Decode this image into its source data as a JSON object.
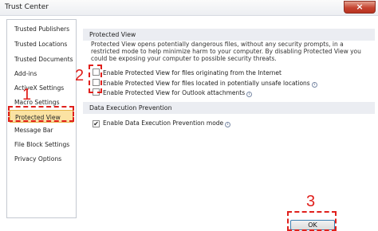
{
  "window": {
    "title": "Trust Center",
    "close_glyph": "×"
  },
  "sidebar": {
    "items": [
      {
        "label": "Trusted Publishers"
      },
      {
        "label": "Trusted Locations"
      },
      {
        "label": "Trusted Documents"
      },
      {
        "label": "Add-ins"
      },
      {
        "label": "ActiveX Settings"
      },
      {
        "label": "Macro Settings"
      },
      {
        "label": "Protected View",
        "selected": true
      },
      {
        "label": "Message Bar"
      },
      {
        "label": "File Block Settings"
      },
      {
        "label": "Privacy Options"
      }
    ]
  },
  "protected_view": {
    "header": "Protected View",
    "description": "Protected View opens potentially dangerous files, without any security prompts, in a restricted mode to help minimize harm to your computer. By disabling Protected View you could be exposing your computer to possible security threats.",
    "options": [
      {
        "label": "Enable Protected View for files originating from the Internet",
        "checked": false
      },
      {
        "label": "Enable Protected View for files located in potentially unsafe locations",
        "checked": false,
        "info": true
      },
      {
        "label": "Enable Protected View for Outlook attachments",
        "checked": false,
        "info": true
      }
    ]
  },
  "data_execution": {
    "header": "Data Execution Prevention",
    "option": {
      "label": "Enable Data Execution Prevention mode",
      "checked": true,
      "info": true
    }
  },
  "footer": {
    "ok_label": "OK"
  },
  "annotations": {
    "step1": "1",
    "step2": "2",
    "step3": "3"
  },
  "icons": {
    "info": "i",
    "check": "✔"
  },
  "colors": {
    "annotation": "#e0201c",
    "selected_bg": "#fbe3a3",
    "close_bg": "#c64532"
  }
}
